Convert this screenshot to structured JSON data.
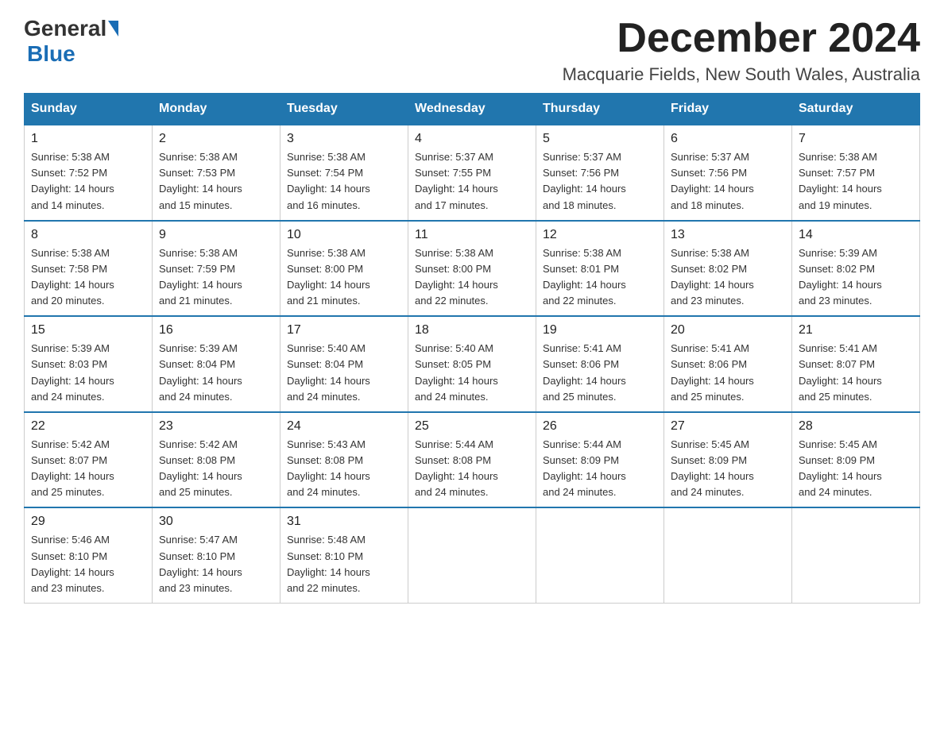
{
  "header": {
    "logo_general": "General",
    "logo_blue": "Blue",
    "month_title": "December 2024",
    "location": "Macquarie Fields, New South Wales, Australia"
  },
  "columns": [
    "Sunday",
    "Monday",
    "Tuesday",
    "Wednesday",
    "Thursday",
    "Friday",
    "Saturday"
  ],
  "weeks": [
    [
      {
        "num": "1",
        "sunrise": "5:38 AM",
        "sunset": "7:52 PM",
        "daylight": "14 hours and 14 minutes."
      },
      {
        "num": "2",
        "sunrise": "5:38 AM",
        "sunset": "7:53 PM",
        "daylight": "14 hours and 15 minutes."
      },
      {
        "num": "3",
        "sunrise": "5:38 AM",
        "sunset": "7:54 PM",
        "daylight": "14 hours and 16 minutes."
      },
      {
        "num": "4",
        "sunrise": "5:37 AM",
        "sunset": "7:55 PM",
        "daylight": "14 hours and 17 minutes."
      },
      {
        "num": "5",
        "sunrise": "5:37 AM",
        "sunset": "7:56 PM",
        "daylight": "14 hours and 18 minutes."
      },
      {
        "num": "6",
        "sunrise": "5:37 AM",
        "sunset": "7:56 PM",
        "daylight": "14 hours and 18 minutes."
      },
      {
        "num": "7",
        "sunrise": "5:38 AM",
        "sunset": "7:57 PM",
        "daylight": "14 hours and 19 minutes."
      }
    ],
    [
      {
        "num": "8",
        "sunrise": "5:38 AM",
        "sunset": "7:58 PM",
        "daylight": "14 hours and 20 minutes."
      },
      {
        "num": "9",
        "sunrise": "5:38 AM",
        "sunset": "7:59 PM",
        "daylight": "14 hours and 21 minutes."
      },
      {
        "num": "10",
        "sunrise": "5:38 AM",
        "sunset": "8:00 PM",
        "daylight": "14 hours and 21 minutes."
      },
      {
        "num": "11",
        "sunrise": "5:38 AM",
        "sunset": "8:00 PM",
        "daylight": "14 hours and 22 minutes."
      },
      {
        "num": "12",
        "sunrise": "5:38 AM",
        "sunset": "8:01 PM",
        "daylight": "14 hours and 22 minutes."
      },
      {
        "num": "13",
        "sunrise": "5:38 AM",
        "sunset": "8:02 PM",
        "daylight": "14 hours and 23 minutes."
      },
      {
        "num": "14",
        "sunrise": "5:39 AM",
        "sunset": "8:02 PM",
        "daylight": "14 hours and 23 minutes."
      }
    ],
    [
      {
        "num": "15",
        "sunrise": "5:39 AM",
        "sunset": "8:03 PM",
        "daylight": "14 hours and 24 minutes."
      },
      {
        "num": "16",
        "sunrise": "5:39 AM",
        "sunset": "8:04 PM",
        "daylight": "14 hours and 24 minutes."
      },
      {
        "num": "17",
        "sunrise": "5:40 AM",
        "sunset": "8:04 PM",
        "daylight": "14 hours and 24 minutes."
      },
      {
        "num": "18",
        "sunrise": "5:40 AM",
        "sunset": "8:05 PM",
        "daylight": "14 hours and 24 minutes."
      },
      {
        "num": "19",
        "sunrise": "5:41 AM",
        "sunset": "8:06 PM",
        "daylight": "14 hours and 25 minutes."
      },
      {
        "num": "20",
        "sunrise": "5:41 AM",
        "sunset": "8:06 PM",
        "daylight": "14 hours and 25 minutes."
      },
      {
        "num": "21",
        "sunrise": "5:41 AM",
        "sunset": "8:07 PM",
        "daylight": "14 hours and 25 minutes."
      }
    ],
    [
      {
        "num": "22",
        "sunrise": "5:42 AM",
        "sunset": "8:07 PM",
        "daylight": "14 hours and 25 minutes."
      },
      {
        "num": "23",
        "sunrise": "5:42 AM",
        "sunset": "8:08 PM",
        "daylight": "14 hours and 25 minutes."
      },
      {
        "num": "24",
        "sunrise": "5:43 AM",
        "sunset": "8:08 PM",
        "daylight": "14 hours and 24 minutes."
      },
      {
        "num": "25",
        "sunrise": "5:44 AM",
        "sunset": "8:08 PM",
        "daylight": "14 hours and 24 minutes."
      },
      {
        "num": "26",
        "sunrise": "5:44 AM",
        "sunset": "8:09 PM",
        "daylight": "14 hours and 24 minutes."
      },
      {
        "num": "27",
        "sunrise": "5:45 AM",
        "sunset": "8:09 PM",
        "daylight": "14 hours and 24 minutes."
      },
      {
        "num": "28",
        "sunrise": "5:45 AM",
        "sunset": "8:09 PM",
        "daylight": "14 hours and 24 minutes."
      }
    ],
    [
      {
        "num": "29",
        "sunrise": "5:46 AM",
        "sunset": "8:10 PM",
        "daylight": "14 hours and 23 minutes."
      },
      {
        "num": "30",
        "sunrise": "5:47 AM",
        "sunset": "8:10 PM",
        "daylight": "14 hours and 23 minutes."
      },
      {
        "num": "31",
        "sunrise": "5:48 AM",
        "sunset": "8:10 PM",
        "daylight": "14 hours and 22 minutes."
      },
      null,
      null,
      null,
      null
    ]
  ],
  "labels": {
    "sunrise": "Sunrise:",
    "sunset": "Sunset:",
    "daylight": "Daylight:"
  }
}
